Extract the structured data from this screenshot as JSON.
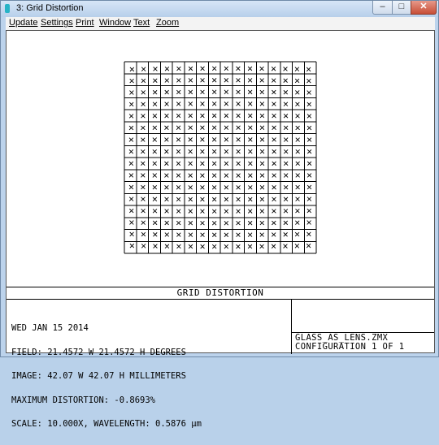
{
  "window": {
    "title": "3: Grid Distortion",
    "close_glyph": "✕",
    "minimize_glyph": "–",
    "maximize_glyph": "□"
  },
  "menu": [
    "Update",
    "Settings",
    "Print",
    "Window",
    "Text",
    "Zoom"
  ],
  "plot": {
    "grid_cells": 16,
    "marker": "x"
  },
  "caption": "GRID DISTORTION",
  "info": {
    "date": "WED JAN 15 2014",
    "field": "FIELD: 21.4572 W 21.4572 H DEGREES",
    "image": "IMAGE: 42.07 W 42.07 H MILLIMETERS",
    "max_distortion": "MAXIMUM DISTORTION: -0.8693%",
    "scale": "SCALE: 10.000X, WAVELENGTH: 0.5876 µm"
  },
  "file_name": "GLASS_AS_LENS.ZMX",
  "configuration": "CONFIGURATION 1 OF 1"
}
